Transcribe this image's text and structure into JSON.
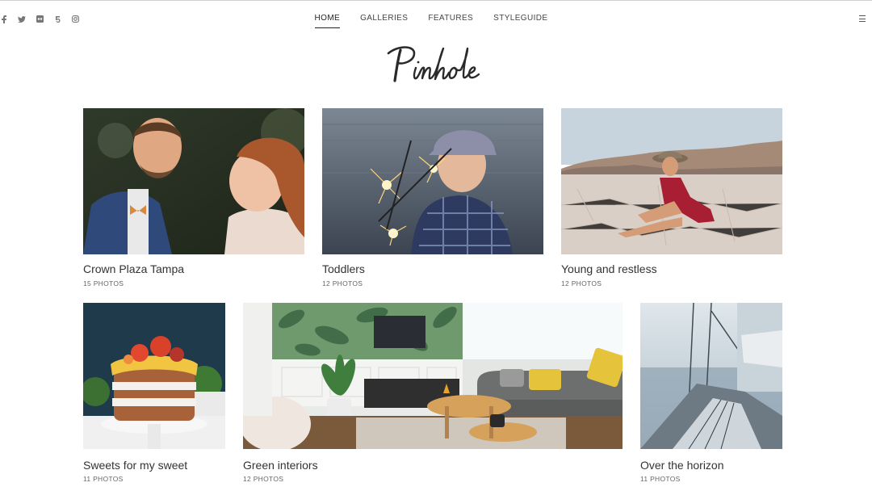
{
  "social": [
    {
      "icon": "facebook-icon"
    },
    {
      "icon": "twitter-icon"
    },
    {
      "icon": "flickr-icon"
    },
    {
      "icon": "500px-icon"
    },
    {
      "icon": "instagram-icon"
    }
  ],
  "nav": {
    "items": [
      {
        "label": "HOME",
        "active": true
      },
      {
        "label": "GALLERIES",
        "active": false
      },
      {
        "label": "FEATURES",
        "active": false
      },
      {
        "label": "STYLEGUIDE",
        "active": false
      }
    ]
  },
  "logo": {
    "text": "Pinhole"
  },
  "galleries": [
    {
      "title": "Crown Plaza Tampa",
      "count": "15 PHOTOS",
      "image": "wedding couple laughing"
    },
    {
      "title": "Toddlers",
      "count": "12 PHOTOS",
      "image": "child with sparklers"
    },
    {
      "title": "Young and restless",
      "count": "12 PHOTOS",
      "image": "woman sitting in desert"
    },
    {
      "title": "Sweets for my sweet",
      "count": "11 PHOTOS",
      "image": "layered cake with fruit"
    },
    {
      "title": "Green interiors",
      "count": "12 PHOTOS",
      "image": "living room with plants"
    },
    {
      "title": "Over the horizon",
      "count": "11 PHOTOS",
      "image": "sailboat deck at sea"
    }
  ],
  "colors": {
    "text": "#333333",
    "meta": "#666666",
    "accent": "#222222"
  }
}
